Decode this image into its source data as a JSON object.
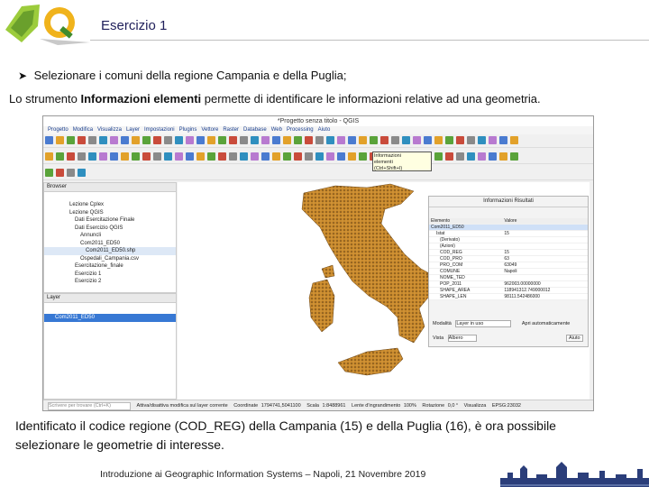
{
  "header": {
    "title": "Esercizio 1"
  },
  "bullet": "Selezionare i comuni della regione Campania e della Puglia;",
  "intro": {
    "before": "Lo strumento ",
    "bold": "Informazioni elementi",
    "after": " permette di identificare le informazioni relative ad una geometria."
  },
  "qgis": {
    "window_title": "*Progetto senza titolo - QGIS",
    "menu": [
      "Progetto",
      "Modifica",
      "Visualizza",
      "Layer",
      "Impostazioni",
      "Plugins",
      "Vettore",
      "Raster",
      "Database",
      "Web",
      "Processing",
      "Aiuto"
    ],
    "browser": {
      "title": "Browser",
      "items": [
        "Lezione Cplex",
        "Lezione QGIS",
        "Dati Esercitazione Finale",
        "Dati Esercizio QGIS",
        "Annuncli",
        "Com2011_ED50",
        "Com2011_ED50.shp",
        "Ospedali_Campania.csv",
        "Esercitazione_finale",
        "Esercizio 1",
        "Esercizio 2"
      ]
    },
    "layers": {
      "title": "Layer",
      "selected": "Com2011_ED50"
    },
    "tooltip": [
      "Informazioni",
      "elementi",
      "(Ctrl+Shift+I)"
    ],
    "identify": {
      "title": "Informazioni Risultati",
      "columns": [
        "Elemento",
        "Valore"
      ],
      "rows": [
        [
          "Com2011_ED50",
          ""
        ],
        [
          "Istat",
          "15"
        ],
        [
          "(Derivato)",
          ""
        ],
        [
          "(Azioni)",
          ""
        ],
        [
          "COD_REG",
          "15"
        ],
        [
          "COD_PRO",
          "63"
        ],
        [
          "PRO_COM",
          "63049"
        ],
        [
          "COMUNE",
          "Napoli"
        ],
        [
          "NOME_TED",
          ""
        ],
        [
          "POP_2011",
          "962003.00000000"
        ],
        [
          "SHAPE_AREA",
          "118941312.749000012"
        ],
        [
          "SHAPE_LEN",
          "98111.542486000"
        ]
      ],
      "mode_label": "Modalità",
      "mode_value": "Layer in uso",
      "auto_open": "Apri automaticamente",
      "view_label": "Vista",
      "view_value": "Albero",
      "help_button": "Aiuto"
    },
    "status": {
      "search_placeholder": "Scrivere per trovare (Ctrl+K)",
      "message": "Attiva/disattiva modifica sul layer corrente",
      "coordinate_label": "Coordinate",
      "coordinate_value": "1794741,5041100",
      "scale_label": "Scala",
      "scale_value": "1:8488961",
      "magnifier_label": "Lente d'ingrandimento",
      "magnifier_value": "100%",
      "rotation_label": "Rotazione",
      "rotation_value": "0,0 °",
      "render_label": "Visualizza",
      "crs": "EPSG:23032"
    }
  },
  "caption": "Identificato il codice regione (COD_REG) della Campania (15) e della Puglia (16), è ora possibile selezionare le geometrie di interesse.",
  "footer": "Introduzione ai Geographic Information Systems – Napoli, 21 Novembre 2019",
  "colors": {
    "map_fill": "#c98a2d",
    "map_dark": "#5a3a12",
    "highlight": "#e0141e",
    "selection": "#3778d4",
    "title": "#1f1f5a"
  }
}
